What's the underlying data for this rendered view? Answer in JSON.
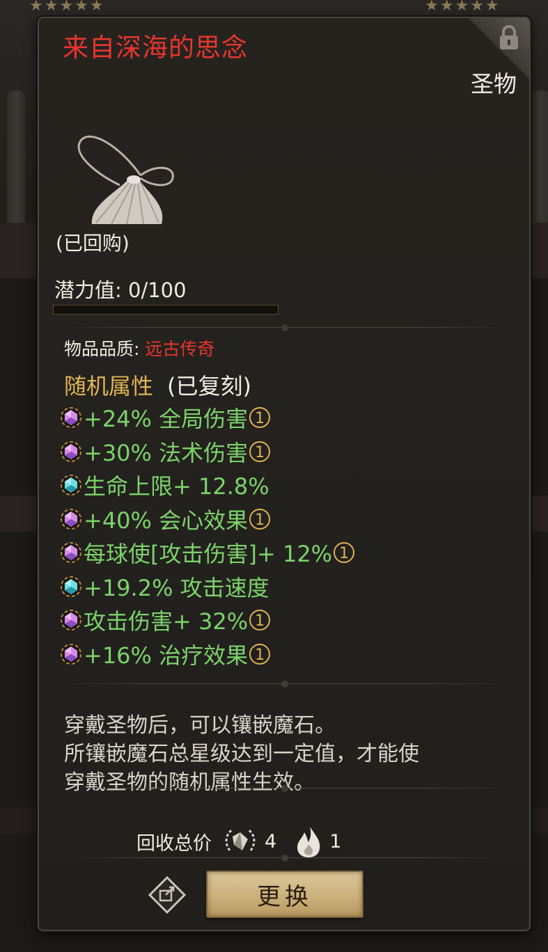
{
  "item": {
    "name": "来自深海的思念",
    "category": "圣物",
    "buyback_status": "(已回购)",
    "potential_label": "潜力值:",
    "potential_text": "0/100",
    "potential_fraction": 0.0,
    "quality_label": "物品品质:",
    "quality_value": "远古传奇",
    "random_attr_label": "随机属性",
    "random_attr_status": "(已复刻)",
    "attributes": [
      {
        "text": "+24% 全局伤害",
        "gem": "purple-gem-icon",
        "has_note": true
      },
      {
        "text": "+30% 法术伤害",
        "gem": "purple-gem-icon",
        "has_note": true
      },
      {
        "text": "生命上限+ 12.8%",
        "gem": "cyan-gem-icon",
        "has_note": false
      },
      {
        "text": "+40% 会心效果",
        "gem": "purple-gem-icon",
        "has_note": true
      },
      {
        "text": "每球使[攻击伤害]+ 12%",
        "gem": "purple-gem-icon",
        "has_note": true
      },
      {
        "text": "+19.2% 攻击速度",
        "gem": "cyan-gem-icon",
        "has_note": false
      },
      {
        "text": "攻击伤害+ 32%",
        "gem": "purple-gem-icon",
        "has_note": true
      },
      {
        "text": "+16% 治疗效果",
        "gem": "purple-gem-icon",
        "has_note": true
      }
    ],
    "note_glyph": "1",
    "description_lines": [
      "穿戴圣物后，可以镶嵌魔石。",
      "所镶嵌魔石总星级达到一定值，才能使",
      "穿戴圣物的随机属性生效。"
    ],
    "recycle_label": "回收总价",
    "recycle_items": [
      {
        "icon": "wreath-crystal-icon",
        "amount": "4"
      },
      {
        "icon": "flame-icon",
        "amount": "1"
      }
    ]
  },
  "buttons": {
    "replace_label": "更换",
    "share_icon": "share-icon"
  },
  "colors": {
    "title_red": "#e8362d",
    "attr_green": "#7cd36a",
    "gold": "#e0b352"
  }
}
